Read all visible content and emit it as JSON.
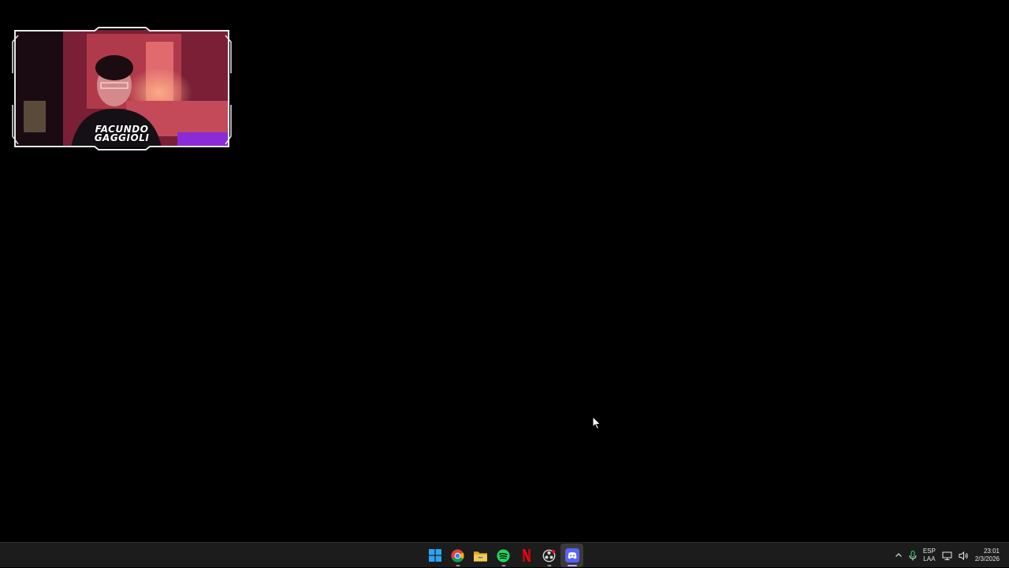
{
  "webcam": {
    "name_line1": "FACUNDO",
    "name_line2": "GAGGIOLI"
  },
  "taskbar": {
    "apps": [
      {
        "name": "start",
        "icon": "windows-start-icon",
        "running": false
      },
      {
        "name": "chrome",
        "icon": "chrome-icon",
        "running": true
      },
      {
        "name": "file-explorer",
        "icon": "folder-icon",
        "running": false
      },
      {
        "name": "spotify",
        "icon": "spotify-icon",
        "running": true
      },
      {
        "name": "netflix",
        "icon": "netflix-icon",
        "running": false
      },
      {
        "name": "obs",
        "icon": "obs-icon",
        "running": true
      },
      {
        "name": "discord",
        "icon": "discord-icon",
        "running": true,
        "active": true
      }
    ],
    "tray": {
      "lang_line1": "ESP",
      "lang_line2": "LAA",
      "time": "23:01",
      "date": "2/3/2026"
    }
  },
  "colors": {
    "desktop_bg": "#000000",
    "taskbar_bg": "#1c1c1c",
    "discord": "#5865f2",
    "spotify": "#1ed760",
    "netflix": "#e50914",
    "start": "#2aa6f5"
  }
}
